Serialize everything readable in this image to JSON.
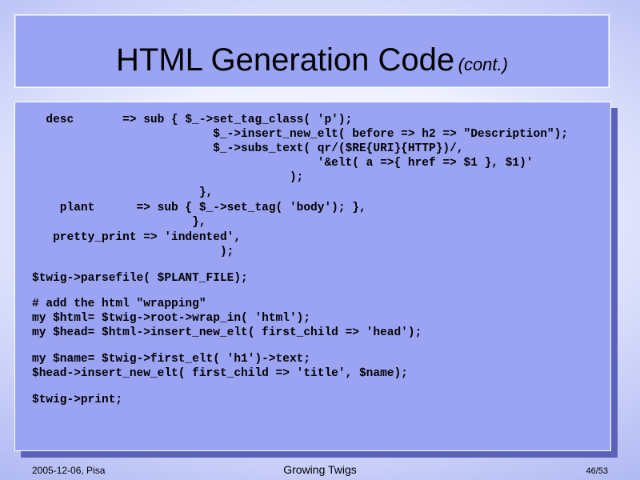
{
  "slide": {
    "title": "HTML Generation Code",
    "title_suffix": "(cont.)"
  },
  "code": [
    "  desc       => sub { $_->set_tag_class( 'p');",
    "                          $_->insert_new_elt( before => h2 => \"Description\");",
    "                          $_->subs_text( qr/($RE{URI}{HTTP})/,",
    "                                         '&elt( a =>{ href => $1 }, $1)'",
    "                                     );",
    "                        },",
    "    plant      => sub { $_->set_tag( 'body'); },",
    "                       },",
    "   pretty_print => 'indented',",
    "                           );",
    "$twig->parsefile( $PLANT_FILE);",
    "# add the html \"wrapping\"",
    "my $html= $twig->root->wrap_in( 'html');",
    "my $head= $html->insert_new_elt( first_child => 'head');",
    "my $name= $twig->first_elt( 'h1')->text;",
    "$head->insert_new_elt( first_child => 'title', $name);",
    "$twig->print;"
  ],
  "footer": {
    "date": "2005-12-06, Pisa",
    "title": "Growing Twigs",
    "page": "46/53"
  }
}
